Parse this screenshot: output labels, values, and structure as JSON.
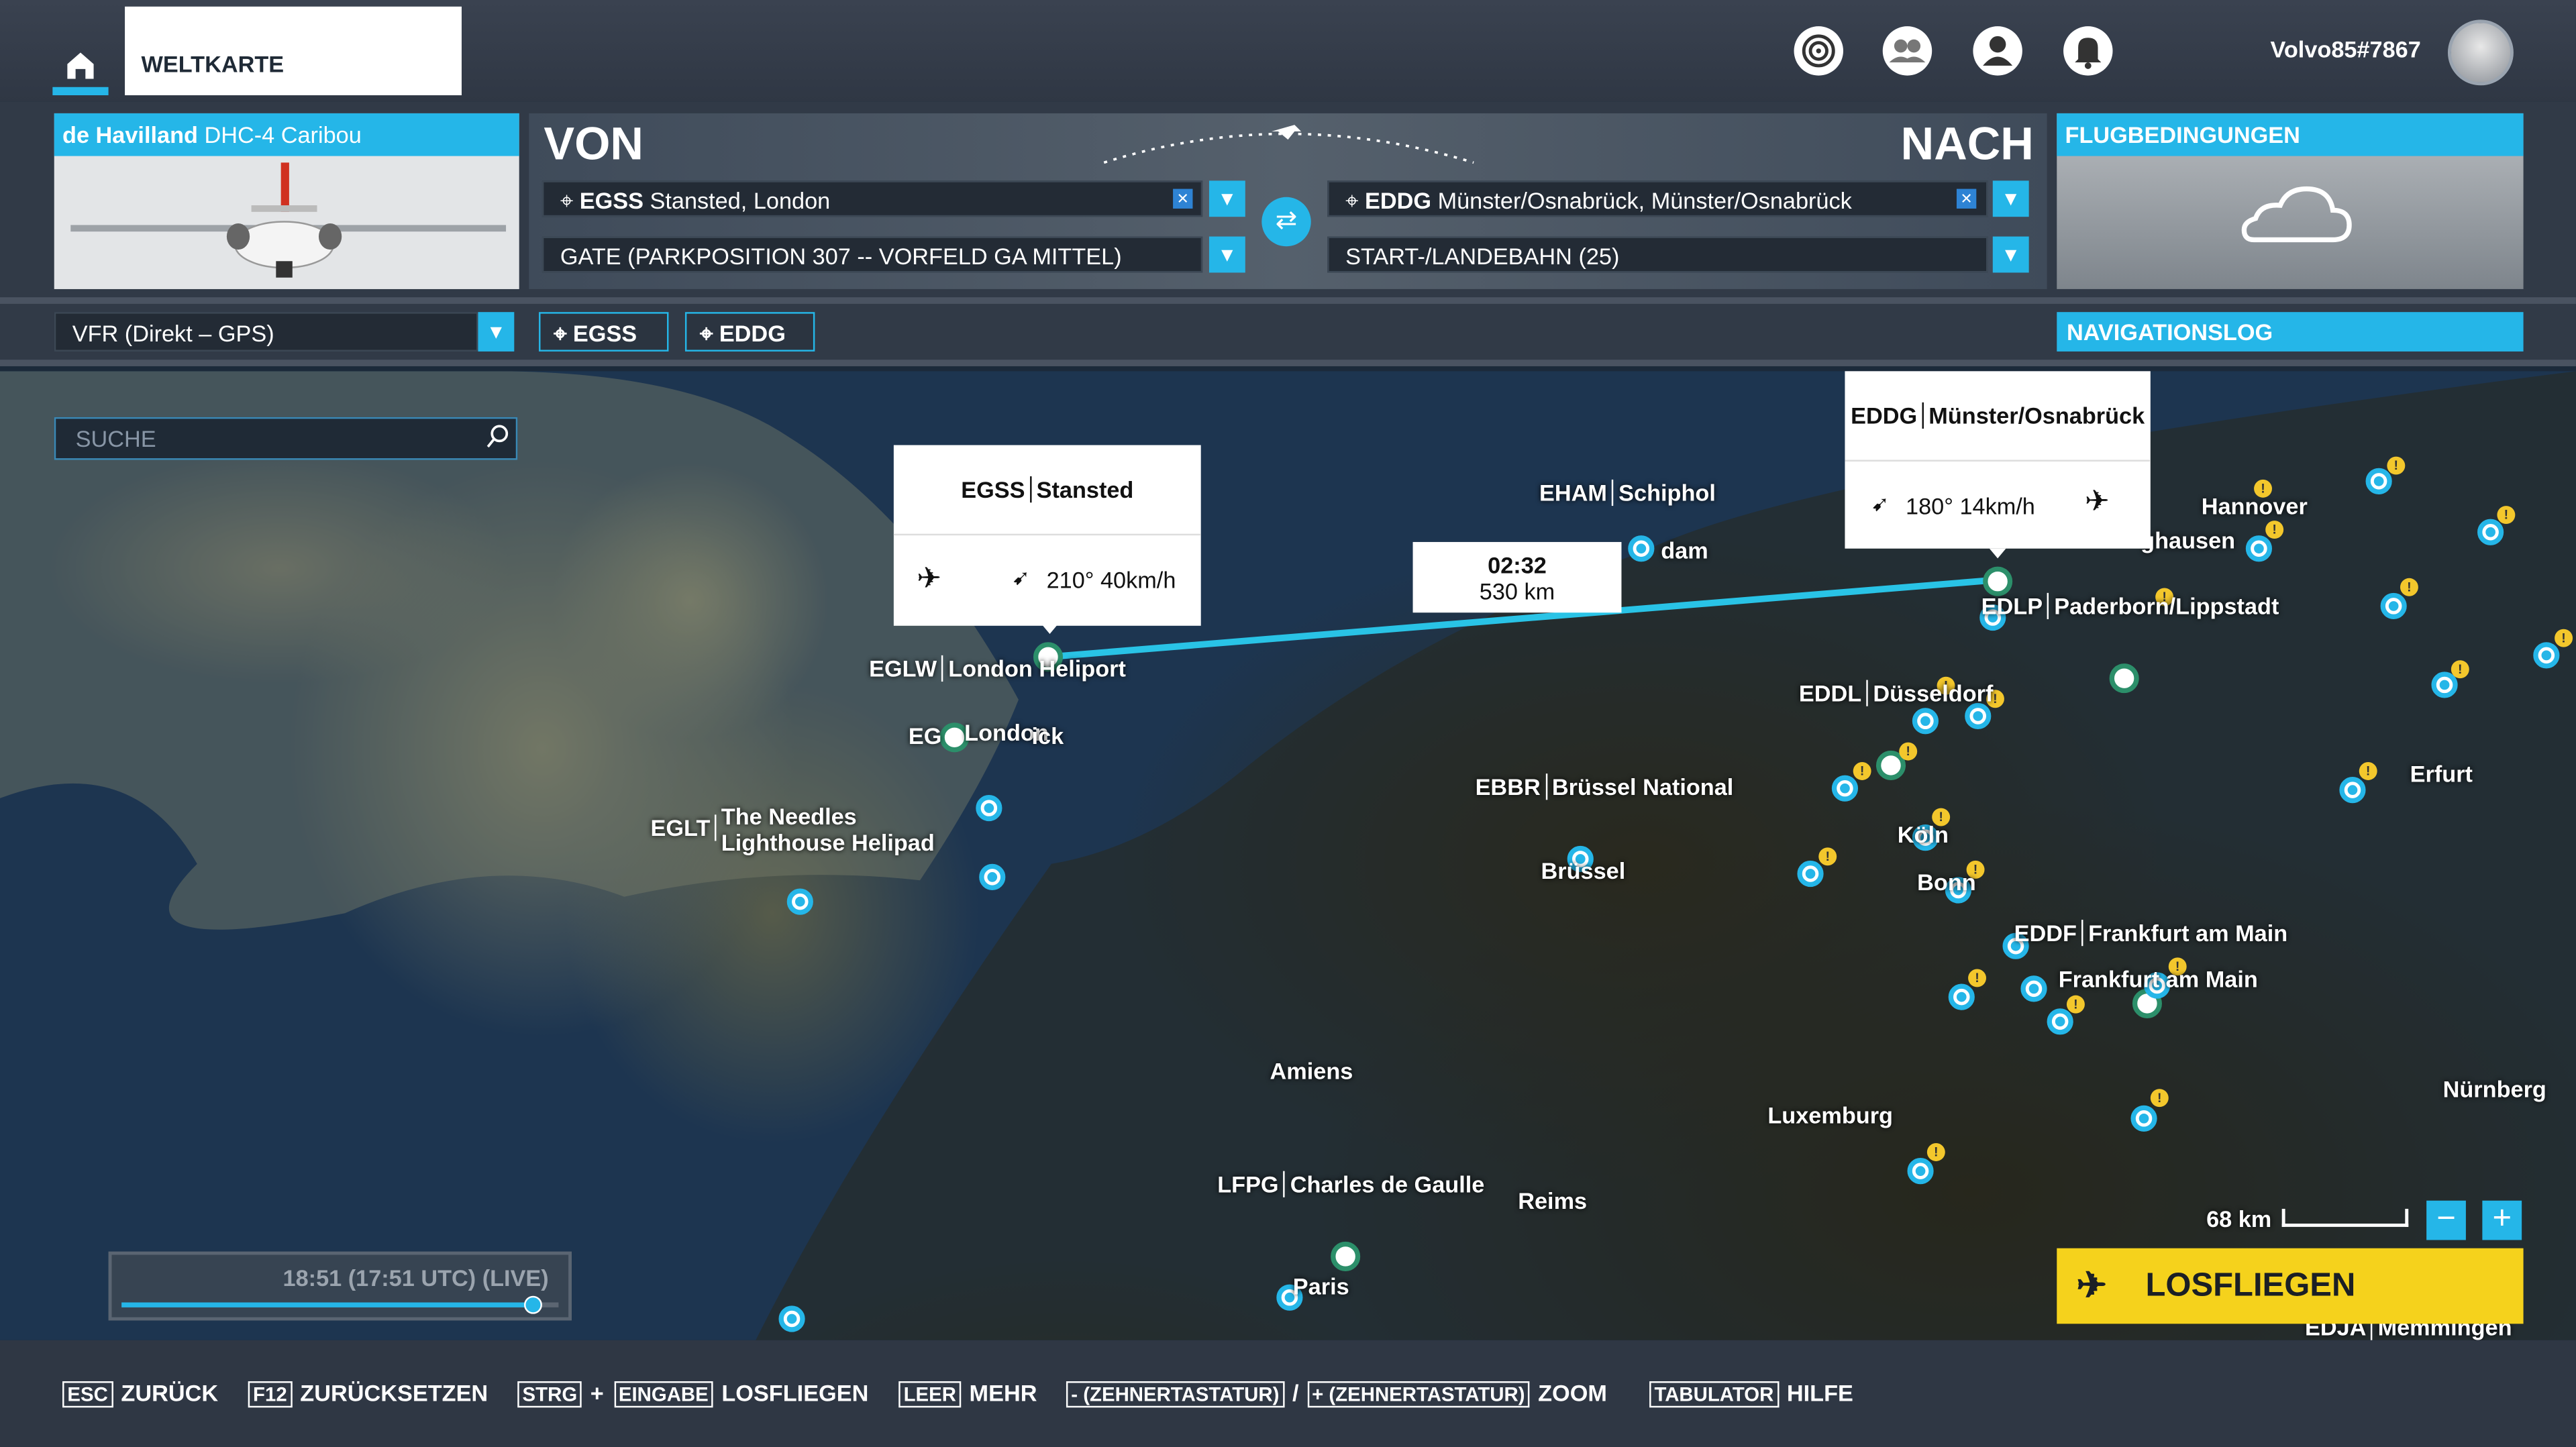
{
  "topbar": {
    "tab_label": "WELTKARTE",
    "username": "Volvo85#7867",
    "icons": [
      "home-icon",
      "target-icon",
      "friends-icon",
      "profile-icon",
      "notifications-icon"
    ]
  },
  "aircraft": {
    "brand": "de Havilland",
    "model": "DHC-4 Caribou"
  },
  "route": {
    "from_title": "VON",
    "to_title": "NACH",
    "from_code": "EGSS",
    "from_name": "Stansted, London",
    "from_gate": "GATE (PARKPOSITION 307 -- VORFELD GA MITTEL)",
    "to_code": "EDDG",
    "to_name": "Münster/Osnabrück, Münster/Osnabrück",
    "to_runway": "START-/LANDEBAHN (25)"
  },
  "weather": {
    "title": "FLUGBEDINGUNGEN"
  },
  "flightplan": {
    "type": "VFR (Direkt – GPS)",
    "chip_from": "EGSS",
    "chip_to": "EDDG",
    "navlog": "NAVIGATIONSLOG"
  },
  "search": {
    "placeholder": "SUCHE"
  },
  "cards": {
    "dep": {
      "code": "EGSS",
      "name": "Stansted",
      "wind": "210° 40km/h"
    },
    "arr": {
      "code": "EDDG",
      "name": "Münster/Osnabrück",
      "wind": "180° 14km/h"
    },
    "leg": {
      "time": "02:32",
      "distance": "530 km"
    }
  },
  "map_labels": {
    "ehem": "EHAM",
    "ehem_name": "Schiphol",
    "amsterdam": "dam",
    "hannover": "Hannover",
    "hausen": "ghausen",
    "edlp": "EDLP",
    "edlp_name": "Paderborn/Lippstadt",
    "eddl": "EDDL",
    "eddl_name": "Düsseldorf",
    "erfurt": "Erfurt",
    "ebbr": "EBBR",
    "ebbr_name": "Brüssel National",
    "bruessel": "Brüssel",
    "koeln": "Köln",
    "bonn": "Bonn",
    "eddf": "EDDF",
    "eddf_name": "Frankfurt am Main",
    "frankfurt": "Frankfurt am Main",
    "eglw": "EGLW",
    "eglw_name": "London Heliport",
    "eg": "EG",
    "london": "London",
    "gatwick": "ick",
    "eglt": "EGLT",
    "eglt_name1": "The Needles",
    "eglt_name2": "Lighthouse Helipad",
    "amiens": "Amiens",
    "luxemburg": "Luxemburg",
    "nuernberg": "Nürnberg",
    "lfpg": "LFPG",
    "lfpg_name": "Charles de Gaulle",
    "reims": "Reims",
    "paris": "Paris",
    "edja": "EDJA",
    "edja_name": "Memmingen"
  },
  "time": {
    "label": "18:51 (17:51 UTC) (LIVE)",
    "progress": 0.94
  },
  "scale": {
    "label": "68 km"
  },
  "zoom": {
    "minus": "−",
    "plus": "+"
  },
  "fly_button": "LOSFLIEGEN",
  "hints": {
    "esc_key": "ESC",
    "esc_label": "ZURÜCK",
    "f12_key": "F12",
    "f12_label": "ZURÜCKSETZEN",
    "strg_key": "STRG",
    "plus": "+",
    "eingabe_key": "EINGABE",
    "eingabe_label": "LOSFLIEGEN",
    "leer_key": "LEER",
    "leer_label": "MEHR",
    "minus_key": "- (ZEHNERTASTATUR)",
    "slash": "/",
    "plus_key": "+ (ZEHNERTASTATUR)",
    "zoom_label": "ZOOM",
    "tab_key": "TABULATOR",
    "tab_label": "HILFE"
  }
}
